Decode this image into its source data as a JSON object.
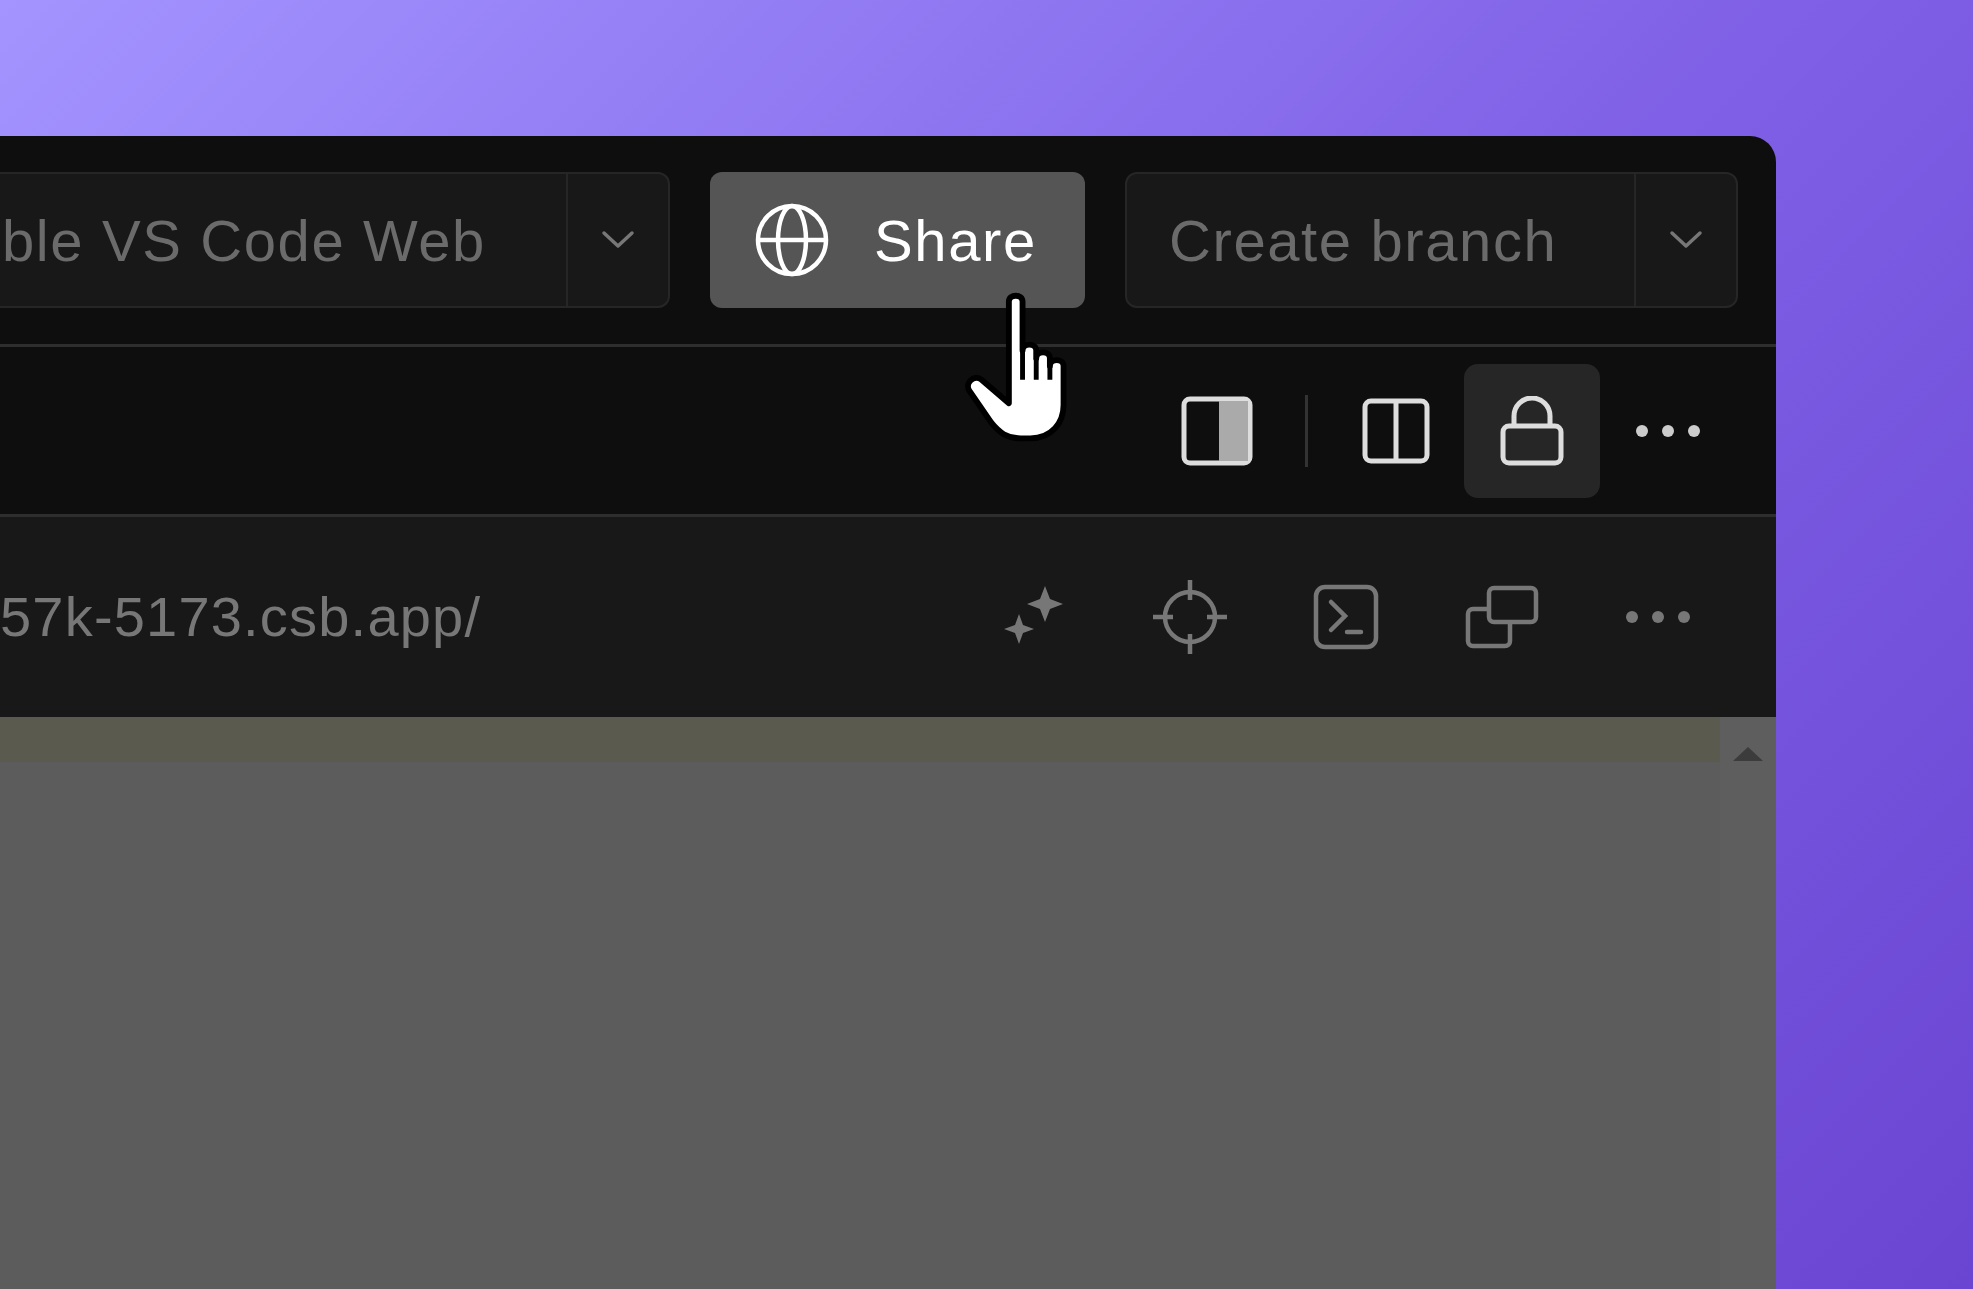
{
  "top_bar": {
    "split_button": {
      "label": "ble VS Code Web"
    },
    "share_button": {
      "label": "Share",
      "hovered": true
    },
    "branch_button": {
      "label": "Create branch"
    }
  },
  "editor_toolbar": [
    {
      "kind": "panel",
      "selected": false
    },
    {
      "kind": "separator"
    },
    {
      "kind": "columns",
      "selected": false
    },
    {
      "kind": "lock",
      "selected": true
    },
    {
      "kind": "more",
      "selected": false
    }
  ],
  "preview_bar": {
    "url": "57k-5173.csb.app/",
    "actions": [
      {
        "kind": "sparkle"
      },
      {
        "kind": "target"
      },
      {
        "kind": "terminal"
      },
      {
        "kind": "windows"
      },
      {
        "kind": "more"
      }
    ]
  }
}
